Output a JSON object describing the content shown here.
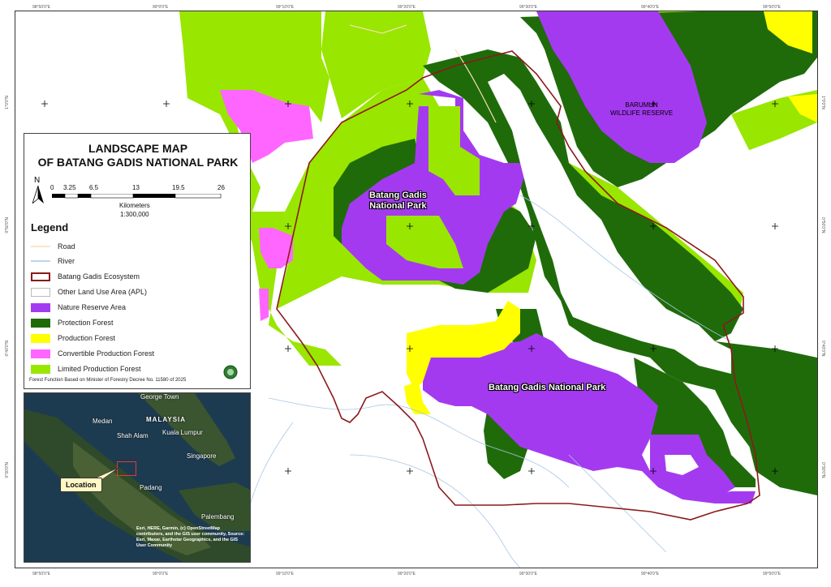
{
  "title": {
    "line1": "LANDSCAPE MAP",
    "line2": "OF BATANG GADIS NATIONAL PARK"
  },
  "north_arrow": {
    "letter": "N"
  },
  "scale": {
    "ticks": [
      "0",
      "3.25",
      "6.5",
      "13",
      "19.5",
      "26"
    ],
    "unit": "Kilometers",
    "ratio": "1:300,000"
  },
  "legend": {
    "heading": "Legend",
    "items": [
      {
        "label": "Road",
        "color": "#f5deb3",
        "symbol": "line"
      },
      {
        "label": "River",
        "color": "#a7c7e7",
        "symbol": "line"
      },
      {
        "label": "Batang Gadis Ecosystem",
        "color": "#8b1a1a",
        "symbol": "outline"
      },
      {
        "label": "Other Land Use Area (APL)",
        "color": "#ffffff",
        "symbol": "fill"
      },
      {
        "label": "Nature Reserve Area",
        "color": "#a43af0",
        "symbol": "fill"
      },
      {
        "label": "Protection Forest",
        "color": "#1f6b0a",
        "symbol": "fill"
      },
      {
        "label": "Production Forest",
        "color": "#ffff00",
        "symbol": "fill"
      },
      {
        "label": "Convertible Production Forest",
        "color": "#ff66ff",
        "symbol": "fill"
      },
      {
        "label": "Limited Production Forest",
        "color": "#99e600",
        "symbol": "fill"
      }
    ],
    "footnote": "Forest Function Based on Minister of Forestry Decree No. 11580 of 2025"
  },
  "map_labels": {
    "park_north": [
      "Batang Gadis",
      "National Park"
    ],
    "park_south": "Batang Gadis National Park",
    "reserve": [
      "BARUMUN",
      "WILDLIFE RESERVE"
    ]
  },
  "coord_ticks": {
    "top": [
      "98°50'0\"E",
      "99°0'0\"E",
      "99°10'0\"E",
      "99°20'0\"E",
      "99°30'0\"E",
      "99°40'0\"E",
      "99°50'0\"E"
    ],
    "bottom": [
      "98°50'0\"E",
      "99°0'0\"E",
      "99°10'0\"E",
      "99°20'0\"E",
      "99°30'0\"E",
      "99°40'0\"E",
      "99°50'0\"E"
    ],
    "left": [
      "1°0'0\"N",
      "0°50'0\"N",
      "0°40'0\"N",
      "0°30'0\"N"
    ],
    "right": [
      "1°0'0\"N",
      "0°50'0\"N",
      "0°40'0\"N",
      "0°30'0\"N"
    ]
  },
  "inset": {
    "labels": {
      "georgetown": "George Town",
      "malaysia": "MALAYSIA",
      "medan": "Medan",
      "shahalam": "Shah Alam",
      "kualalumpur": "Kuala Lumpur",
      "singapore": "Singapore",
      "padang": "Padang",
      "palembang": "Palembang"
    },
    "location": "Location",
    "attribution": "Esri, HERE, Garmin, (c) OpenStreetMap contributors, and the GIS user community, Source: Esri, Maxar, Earthstar Geographics, and the GIS User Community"
  },
  "colors": {
    "apl": "#ffffff",
    "nature_reserve": "#a43af0",
    "protection": "#1f6b0a",
    "production": "#ffff00",
    "convertible": "#ff66ff",
    "limited": "#99e600",
    "ecosystem_boundary": "#8b1a1a",
    "river": "#a7c7e7",
    "road": "#f5deb3"
  }
}
